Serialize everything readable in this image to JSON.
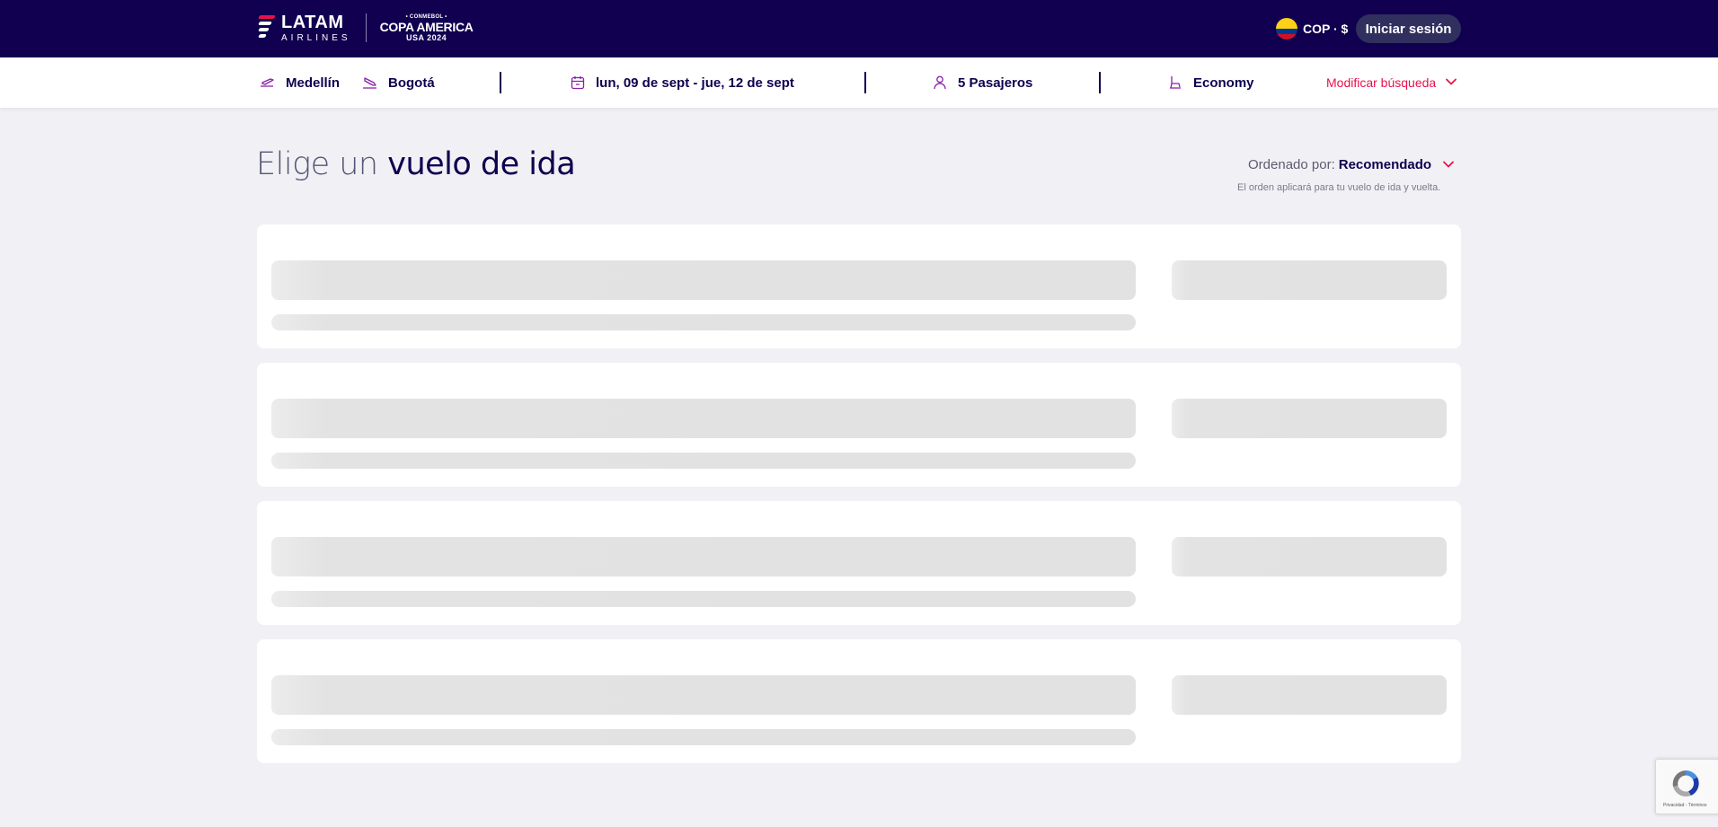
{
  "header": {
    "brand": {
      "name": "LATAM",
      "sub": "AIRLINES"
    },
    "partner": {
      "top": "• CONMEBOL •",
      "mid": "COPA AMERICA",
      "bot": "USA 2024"
    },
    "currency": "COP · $",
    "login_label": "Iniciar sesión",
    "flag_colors": [
      "#fcd116",
      "#003893",
      "#ce1126"
    ],
    "logo_stripe_colors": [
      "#e8114b",
      "#ffffff",
      "#ffffff",
      "#ffffff"
    ]
  },
  "search": {
    "origin": "Medellín",
    "destination": "Bogotá",
    "dates": "lun, 09 de sept - jue, 12 de sept",
    "passengers": "5 Pasajeros",
    "cabin": "Economy",
    "modify_label": "Modificar búsqueda",
    "icons": [
      "takeoff-icon",
      "landing-icon",
      "calendar-icon",
      "person-icon",
      "seat-icon",
      "chevron-down-icon"
    ]
  },
  "results": {
    "title_light": "Elige un",
    "title_bold": "vuelo de ida",
    "sort_label": "Ordenado por:",
    "sort_value": "Recomendado",
    "sort_note": "El orden aplicará para tu vuelo de ida y vuelta.",
    "loading_cards": 4
  },
  "recaptcha": {
    "text": "Privacidad - Términos"
  },
  "colors": {
    "header_bg": "#10004f",
    "accent": "#e8114b",
    "page_bg": "#f1f1f5",
    "skeleton": "#e2e2e2"
  }
}
